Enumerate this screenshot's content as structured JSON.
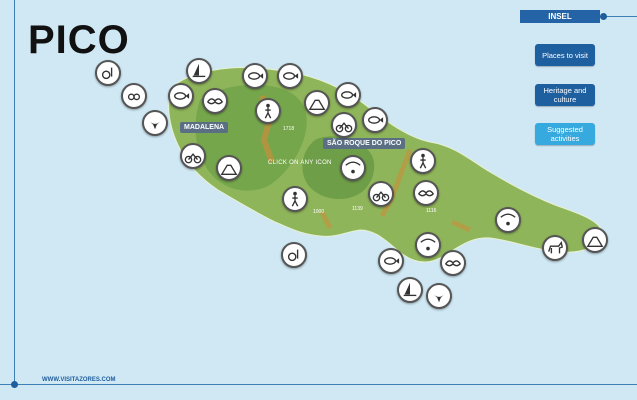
{
  "title": "PICO",
  "insel_label": "INSEL",
  "buttons": {
    "places": "Places to visit",
    "heritage": "Heritage and culture",
    "activities": "Suggested activities"
  },
  "labels": {
    "madalena": "MADALENA",
    "sao_roque": "SÃO ROQUE DO PICO",
    "hint": "CLICK ON ANY ICON",
    "website": "WWW.VISITAZORES.COM"
  },
  "elevations": [
    "1718",
    "1129",
    "1139",
    "1000",
    "1116"
  ],
  "colors": {
    "sea": "#cfe8f4",
    "island": "#8fb55a",
    "mountain": "#5f9440",
    "accent": "#1e5f9f",
    "accent_light": "#36a9de"
  }
}
